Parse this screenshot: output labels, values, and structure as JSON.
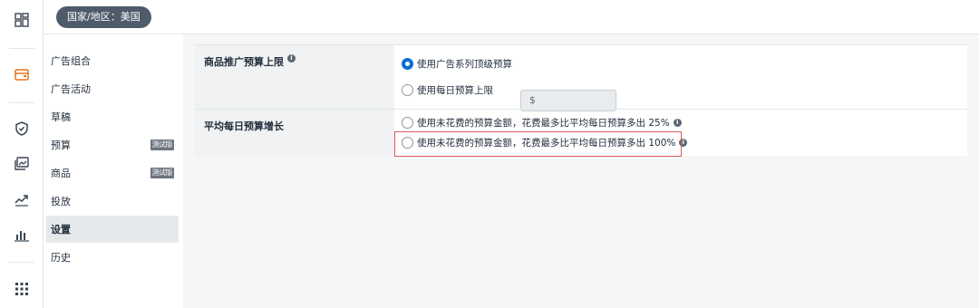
{
  "rail": {
    "icons": [
      "dashboard-icon",
      "wallet-icon",
      "shield-icon",
      "gallery-icon",
      "trend-icon",
      "bar-chart-icon",
      "apps-grid-icon"
    ],
    "active_color": "#e2741f"
  },
  "topbar": {
    "country_label": "国家/地区：美国"
  },
  "subnav": {
    "items": [
      {
        "label": "广告组合"
      },
      {
        "label": "广告活动"
      },
      {
        "label": "草稿"
      },
      {
        "label": "预算",
        "badge": "测试版"
      },
      {
        "label": "商品",
        "badge": "测试版"
      },
      {
        "label": "投放"
      },
      {
        "label": "设置",
        "active": true
      },
      {
        "label": "历史"
      }
    ]
  },
  "settings": {
    "budget_cap": {
      "label": "商品推广预算上限",
      "option_campaign": "使用广告系列顶级预算",
      "option_daily": "使用每日预算上限",
      "currency_placeholder": "$",
      "selected": "campaign"
    },
    "avg_daily": {
      "label": "平均每日预算增长",
      "option_25": "使用未花费的预算金额，花费最多比平均每日预算多出 25%",
      "option_100": "使用未花费的预算金额，花费最多比平均每日预算多出 100%",
      "highlighted": "option_100"
    }
  },
  "colors": {
    "accent_blue": "#0a6ed1",
    "highlight_red": "#e05a5a",
    "pill_bg": "#4e5b6b"
  }
}
